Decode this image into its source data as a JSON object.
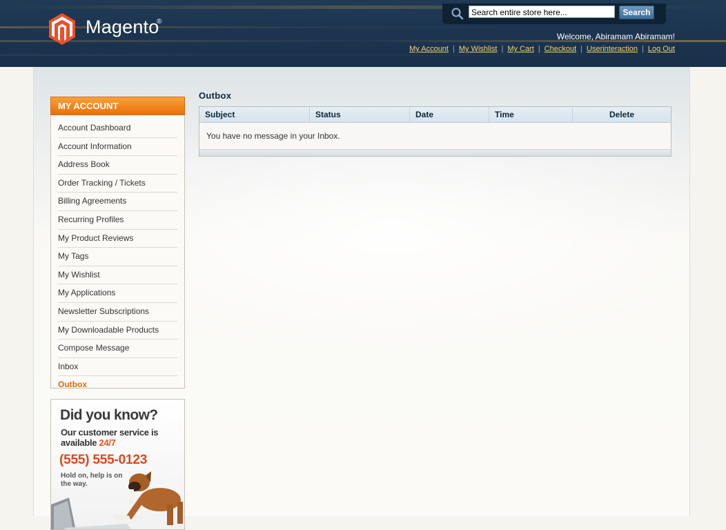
{
  "header": {
    "logo_text": "Magento",
    "logo_reg": "®",
    "search": {
      "placeholder": "Search entire store here...",
      "value": "Search entire store here...",
      "button_label": "Search"
    },
    "welcome": "Welcome, Abiramam Abiramam!",
    "links": [
      "My Account",
      "My Wishlist",
      "My Cart",
      "Checkout",
      "Userinteraction",
      "Log Out"
    ]
  },
  "sidebar": {
    "title": "MY ACCOUNT",
    "items": [
      {
        "label": "Account Dashboard"
      },
      {
        "label": "Account Information"
      },
      {
        "label": "Address Book"
      },
      {
        "label": "Order Tracking / Tickets"
      },
      {
        "label": "Billing Agreements"
      },
      {
        "label": "Recurring Profiles"
      },
      {
        "label": "My Product Reviews"
      },
      {
        "label": "My Tags"
      },
      {
        "label": "My Wishlist"
      },
      {
        "label": "My Applications"
      },
      {
        "label": "Newsletter Subscriptions"
      },
      {
        "label": "My Downloadable Products"
      },
      {
        "label": "Compose Message"
      },
      {
        "label": "Inbox"
      },
      {
        "label": "Outbox"
      }
    ],
    "current": "Outbox"
  },
  "banner": {
    "title": "Did you know?",
    "line1": "Our customer service is",
    "line2_prefix": "available ",
    "line2_highlight": "24/7",
    "phone": "(555) 555-0123",
    "hold": "Hold on, help is on the way."
  },
  "main": {
    "title": "Outbox",
    "columns": [
      "Subject",
      "Status",
      "Date",
      "Time",
      "Delete"
    ],
    "empty_message": "You have no message in your Inbox."
  },
  "colors": {
    "header_bg": "#1d3550",
    "accent_orange": "#e9700b",
    "link_yellow": "#f5d17a",
    "current_nav": "#e26703"
  }
}
